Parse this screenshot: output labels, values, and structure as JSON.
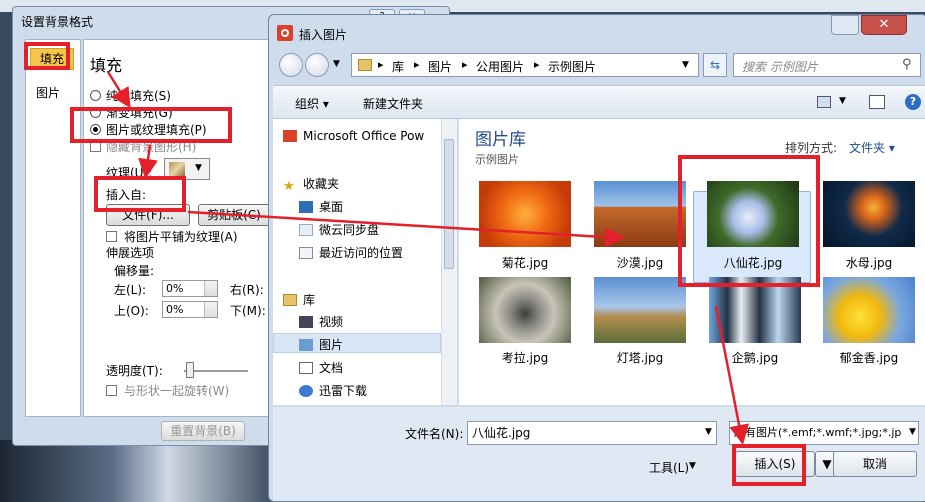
{
  "format_dialog": {
    "title": "设置背景格式",
    "ctrl_help": "?",
    "ctrl_close": "×",
    "nav": {
      "fill": "填充",
      "picture": "图片"
    },
    "heading": "填充",
    "options": {
      "solid": "纯色填充(S)",
      "gradient": "渐变填充(G)",
      "picture_texture": "图片或纹理填充(P)",
      "hide_bg": "隐藏背景图形(H)"
    },
    "texture_label": "纹理(U):",
    "insert_from": "插入自:",
    "file_button": "文件(F)...",
    "clipboard_button": "剪贴板(C)",
    "tile_check": "将图片平铺为纹理(A)",
    "stretch": "伸展选项",
    "offset": "偏移量:",
    "left": "左(L):",
    "top": "上(O):",
    "right": "右(R):",
    "bottom": "下(M):",
    "left_val": "0%",
    "top_val": "0%",
    "transparency": "透明度(T):",
    "rotate": "与形状一起旋转(W)",
    "reset": "重置背景(B)"
  },
  "insert_dialog": {
    "title": "插入图片",
    "close": "✕",
    "breadcrumb": [
      "库",
      "图片",
      "公用图片",
      "示例图片"
    ],
    "search_placeholder": "搜索 示例图片",
    "toolbar": {
      "organize": "组织 ▾",
      "new_folder": "新建文件夹"
    },
    "nav": [
      {
        "label": "Microsoft Office Pow",
        "icon": "office-icon"
      },
      {
        "label": "收藏夹",
        "icon": "star-icon"
      },
      {
        "label": "桌面",
        "icon": "desktop-icon"
      },
      {
        "label": "微云同步盘",
        "icon": "cloud-icon"
      },
      {
        "label": "最近访问的位置",
        "icon": "recent-icon"
      },
      {
        "label": "库",
        "icon": "library-icon"
      },
      {
        "label": "视频",
        "icon": "video-icon"
      },
      {
        "label": "图片",
        "icon": "pictures-icon"
      },
      {
        "label": "文档",
        "icon": "documents-icon"
      },
      {
        "label": "迅雷下载",
        "icon": "download-icon"
      }
    ],
    "library_title": "图片库",
    "library_sub": "示例图片",
    "sort_label": "排列方式:",
    "sort_value": "文件夹 ▾",
    "files": [
      {
        "name": "菊花.jpg"
      },
      {
        "name": "沙漠.jpg"
      },
      {
        "name": "八仙花.jpg"
      },
      {
        "name": "水母.jpg"
      },
      {
        "name": "考拉.jpg"
      },
      {
        "name": "灯塔.jpg"
      },
      {
        "name": "企鹅.jpg"
      },
      {
        "name": "郁金香.jpg"
      }
    ],
    "filename_label": "文件名(N):",
    "filename_value": "八仙花.jpg",
    "filetype_value": "所有图片(*.emf;*.wmf;*.jpg;*.jp",
    "tools": "工具(L)",
    "insert_button": "插入(S)",
    "cancel_button": "取消"
  },
  "colors": {
    "highlight_red": "#e4202a",
    "accent_blue": "#1f4e8c"
  }
}
